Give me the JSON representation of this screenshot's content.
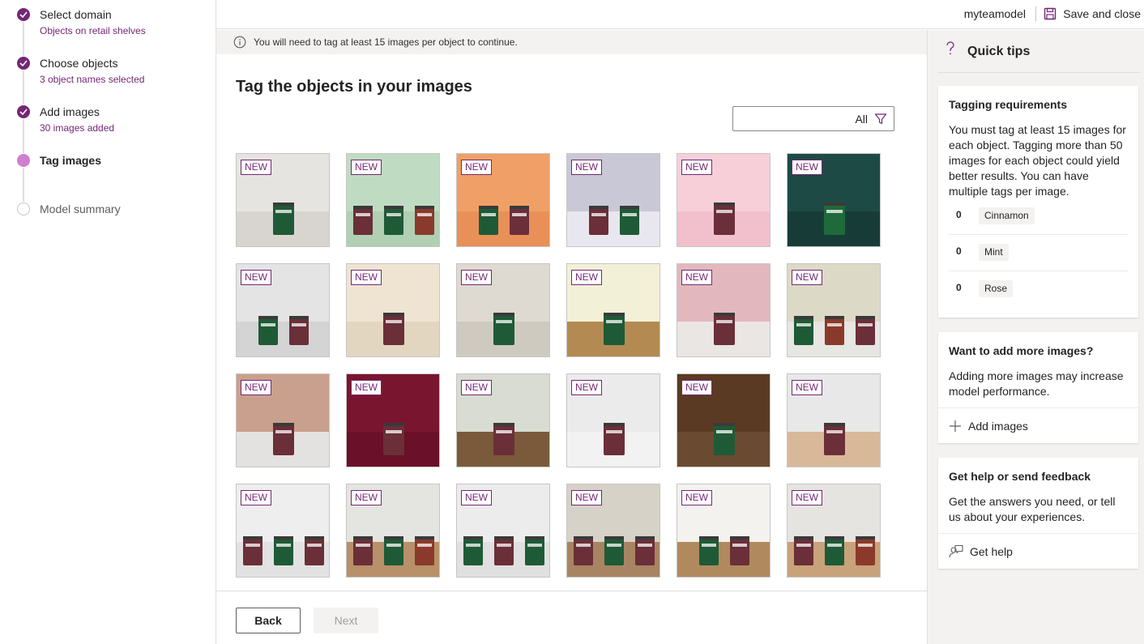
{
  "stepper": {
    "steps": [
      {
        "title": "Select domain",
        "subtitle": "Objects on retail shelves",
        "state": "done"
      },
      {
        "title": "Choose objects",
        "subtitle": "3 object names selected",
        "state": "done"
      },
      {
        "title": "Add images",
        "subtitle": "30 images added",
        "state": "done"
      },
      {
        "title": "Tag images",
        "subtitle": "",
        "state": "current"
      },
      {
        "title": "Model summary",
        "subtitle": "",
        "state": "todo"
      }
    ]
  },
  "topbar": {
    "user": "myteamodel",
    "save_close_label": "Save and close"
  },
  "infobar": {
    "message": "You will need to tag at least 15 images per object to continue."
  },
  "main": {
    "title": "Tag the objects in your images",
    "filter_label": "All",
    "badge_label": "NEW",
    "tiles": [
      {
        "bg": "#e6e4e0",
        "floor": "#d8d5d0",
        "cans": [
          "#1f5a36"
        ]
      },
      {
        "bg": "#bfdcc2",
        "floor": "#b0cfb3",
        "cans": [
          "#6a2f38",
          "#1f5a36",
          "#8a3a2a"
        ]
      },
      {
        "bg": "#f0a066",
        "floor": "#e89058",
        "cans": [
          "#1f5a36",
          "#6a2f38"
        ]
      },
      {
        "bg": "#c9c8d6",
        "floor": "#e8e6ee",
        "cans": [
          "#6a2f38",
          "#1f5a36"
        ]
      },
      {
        "bg": "#f7cfd9",
        "floor": "#f2c0cc",
        "cans": [
          "#6a2f38"
        ]
      },
      {
        "bg": "#1e4a45",
        "floor": "#173c38",
        "cans": [
          "#1f6a3a"
        ]
      },
      {
        "bg": "#e4e4e4",
        "floor": "#d4d4d4",
        "cans": [
          "#1f5a36",
          "#6a2f38"
        ]
      },
      {
        "bg": "#efe4d2",
        "floor": "#e3d6c0",
        "cans": [
          "#6a2f38"
        ]
      },
      {
        "bg": "#dedad2",
        "floor": "#cfcac0",
        "cans": [
          "#1f5a36"
        ]
      },
      {
        "bg": "#f3f0d8",
        "floor": "#b38a52",
        "cans": [
          "#1f5a36"
        ]
      },
      {
        "bg": "#e2b8be",
        "floor": "#e9e6e4",
        "cans": [
          "#6a2f38"
        ]
      },
      {
        "bg": "#dcdac6",
        "floor": "#e6e6e2",
        "cans": [
          "#1f5a36",
          "#8a3a2a",
          "#6a2f38"
        ]
      },
      {
        "bg": "#c9a08e",
        "floor": "#e4e2e0",
        "cans": [
          "#6a2f38"
        ]
      },
      {
        "bg": "#7a1530",
        "floor": "#6a1028",
        "cans": [
          "#6a2f38"
        ]
      },
      {
        "bg": "#d8dcd2",
        "floor": "#7a5a3a",
        "cans": [
          "#6a2f38"
        ]
      },
      {
        "bg": "#ebebeb",
        "floor": "#f2f2f2",
        "cans": [
          "#6a2f38"
        ]
      },
      {
        "bg": "#5a3a22",
        "floor": "#6a4a30",
        "cans": [
          "#1f5a36"
        ]
      },
      {
        "bg": "#e8e8e8",
        "floor": "#d9b89a",
        "cans": [
          "#6a2f38"
        ]
      },
      {
        "bg": "#eeeeee",
        "floor": "#e2e2e2",
        "cans": [
          "#6a2f38",
          "#1f5a36",
          "#6a2f38"
        ]
      },
      {
        "bg": "#e4e4e0",
        "floor": "#b8906a",
        "cans": [
          "#6a2f38",
          "#1f5a36",
          "#8a3a2a"
        ]
      },
      {
        "bg": "#ececec",
        "floor": "#e0e0e0",
        "cans": [
          "#1f5a36",
          "#6a2f38",
          "#1f5a36"
        ]
      },
      {
        "bg": "#d6d2c8",
        "floor": "#a88462",
        "cans": [
          "#6a2f38",
          "#1f5a36",
          "#6a2f38"
        ]
      },
      {
        "bg": "#f4f2ee",
        "floor": "#b08a5e",
        "cans": [
          "#1f5a36",
          "#6a2f38"
        ]
      },
      {
        "bg": "#e6e4e0",
        "floor": "#c8a27a",
        "cans": [
          "#6a2f38",
          "#1f5a36",
          "#8a3a2a"
        ]
      }
    ]
  },
  "footer": {
    "back_label": "Back",
    "next_label": "Next"
  },
  "tips": {
    "title": "Quick tips",
    "requirements": {
      "title": "Tagging requirements",
      "text": "You must tag at least 15 images for each object. Tagging more than 50 images for each object could yield better results. You can have multiple tags per image.",
      "tags": [
        {
          "count": "0",
          "name": "Cinnamon"
        },
        {
          "count": "0",
          "name": "Mint"
        },
        {
          "count": "0",
          "name": "Rose"
        }
      ]
    },
    "more_images": {
      "title": "Want to add more images?",
      "text": "Adding more images may increase model performance.",
      "action": "Add images"
    },
    "help": {
      "title": "Get help or send feedback",
      "text": "Get the answers you need, or tell us about your experiences.",
      "action": "Get help"
    }
  },
  "colors": {
    "accent": "#742774",
    "accent_light": "#d17ed1"
  }
}
